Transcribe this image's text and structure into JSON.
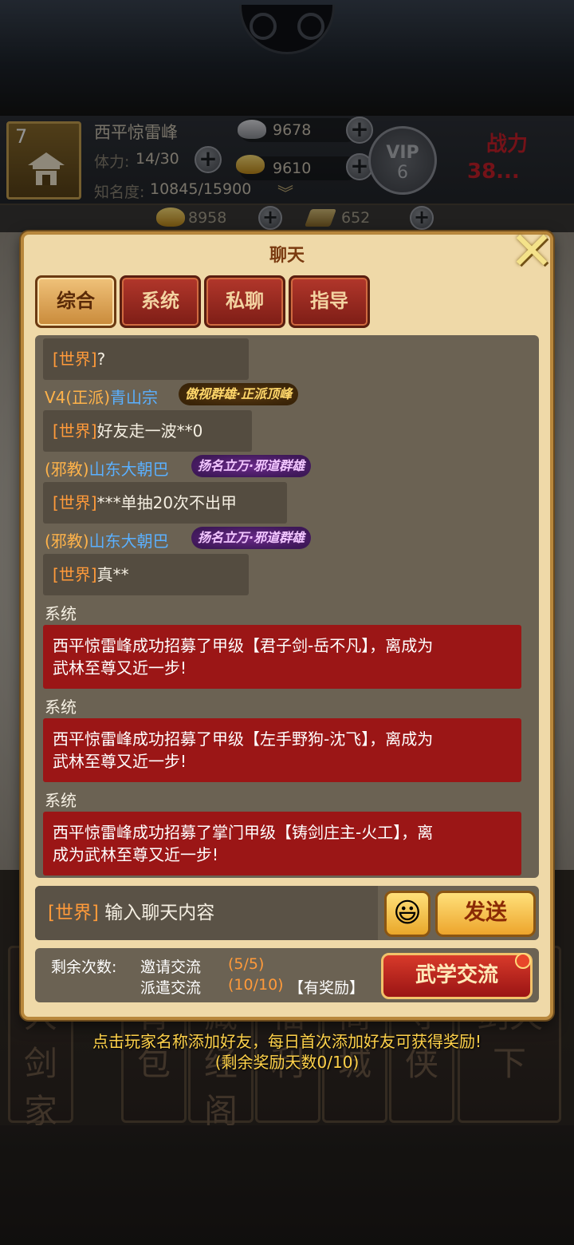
{
  "player": {
    "level": "7",
    "name": "西平惊雷峰",
    "stamina_label": "体力:",
    "stamina_value": "14/30",
    "fame_label": "知名度:",
    "fame_value": "10845/15900",
    "silver": "9678",
    "gold": "9610",
    "vip_label": "VIP",
    "vip_level": "6",
    "power_label": "战力",
    "power_value": "38...",
    "res_ingot": "8958",
    "res_token": "652"
  },
  "dialog": {
    "title": "聊天",
    "tabs": [
      "综合",
      "系统",
      "私聊",
      "指导"
    ],
    "active_tab": "综合"
  },
  "chat": {
    "msg1": {
      "tag": "[世界]",
      "text": "?"
    },
    "sender2": {
      "prefix": "V4(正派)",
      "name": "青山宗",
      "badge": "傲视群雄·正派顶峰"
    },
    "msg2": {
      "tag": "[世界]",
      "text": "好友走一波**0"
    },
    "sender3": {
      "sect": "(邪教)",
      "name": "山东大朝巴",
      "badge": "扬名立万·邪道群雄"
    },
    "msg3": {
      "tag": "[世界]",
      "text": "***单抽20次不出甲"
    },
    "sender4": {
      "sect": "(邪教)",
      "name": "山东大朝巴",
      "badge": "扬名立万·邪道群雄"
    },
    "msg4": {
      "tag": "[世界]",
      "text": "真**"
    },
    "sys_label": "系统",
    "sys1_line1": "西平惊雷峰成功招募了甲级【君子剑-岳不凡】，离成为",
    "sys1_line2": "武林至尊又近一步!",
    "sys2_line1": "西平惊雷峰成功招募了甲级【左手野狗-沈飞】，离成为",
    "sys2_line2": "武林至尊又近一步!",
    "sys3_line1": "西平惊雷峰成功招募了掌门甲级【铸剑庄主-火工】，离",
    "sys3_line2": "成为武林至尊又近一步!"
  },
  "input": {
    "channel_tag": "[世界]",
    "placeholder": "输入聊天内容",
    "emoji_icon": "😃",
    "send_label": "发送"
  },
  "exchange": {
    "remaining_label": "剩余次数:",
    "invite_label": "邀请交流",
    "invite_count": "(5/5)",
    "dispatch_label": "派遣交流",
    "dispatch_count": "(10/10)",
    "reward_tag": "【有奖励】",
    "button_label": "武学交流"
  },
  "hint": {
    "line1": "点击玩家名称添加好友，每日首次添加好友可获得奖励!",
    "line2": "(剩余奖励天数0/10)"
  },
  "bottom_menu": [
    "大剑家",
    "背包",
    "藏经阁",
    "福利",
    "商城",
    "寻侠",
    "剑天下"
  ],
  "colors": {
    "tab_active": "#c98a3a",
    "tab_inactive": "#9b2a20",
    "world_tag": "#ff9a3a",
    "player_name": "#5ab0ff",
    "system_bg": "#9b1616",
    "hint": "#ffd24a"
  }
}
